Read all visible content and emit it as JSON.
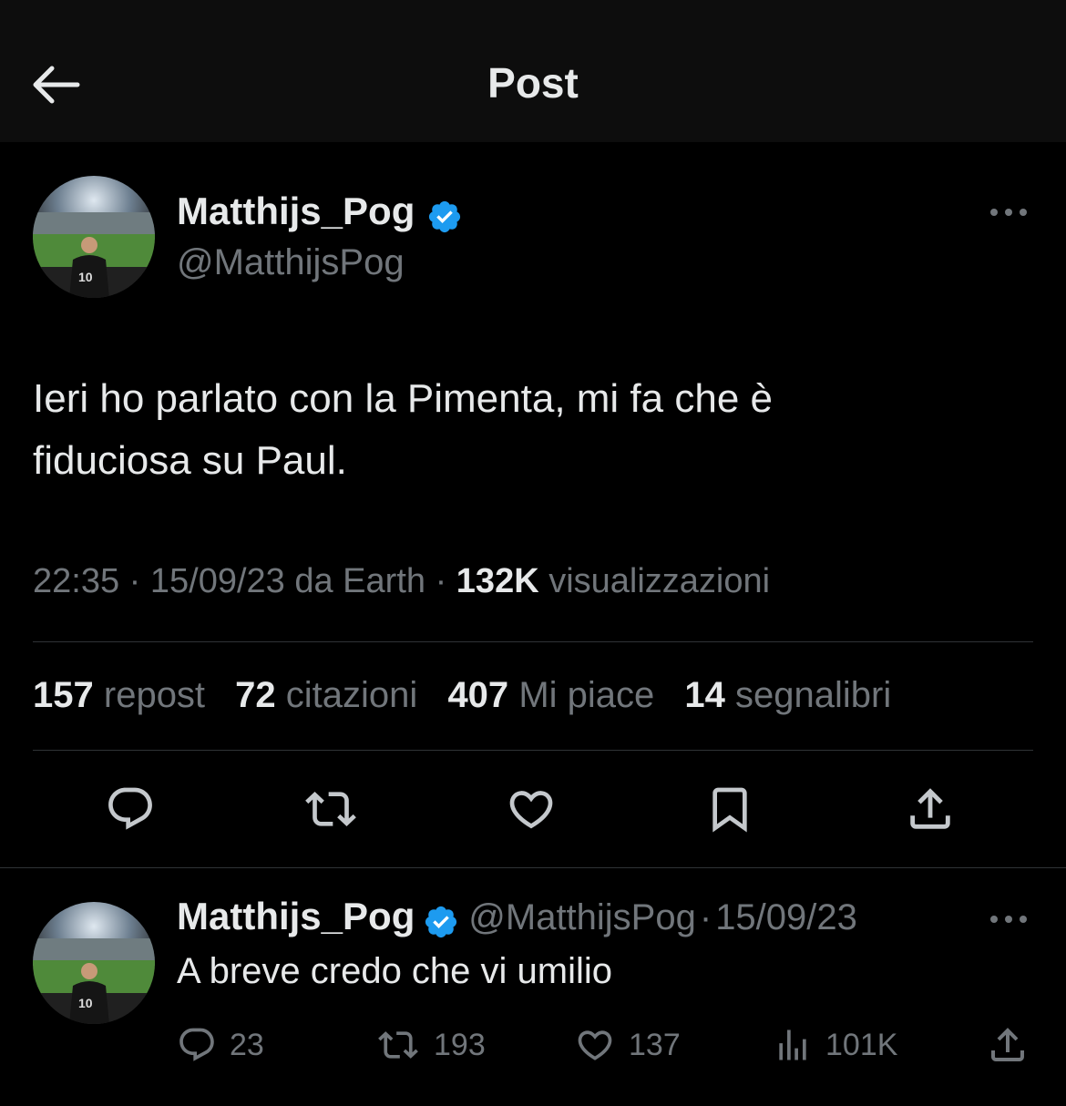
{
  "header": {
    "title": "Post"
  },
  "post": {
    "author_name": "Matthijs_Pog",
    "author_handle": "@MatthijsPog",
    "text_line1": "Ieri ho parlato con la Pimenta, mi fa che è",
    "text_line2": "fiduciosa su Paul.",
    "time": "22:35",
    "sep1": " · ",
    "date": "15/09/23",
    "source": " da Earth",
    "sep2": " · ",
    "views_count": "132K",
    "views_label": " visualizzazioni",
    "stats": {
      "reposts_count": "157",
      "reposts_label": "repost",
      "quotes_count": "72",
      "quotes_label": "citazioni",
      "likes_count": "407",
      "likes_label": "Mi piace",
      "bookmarks_count": "14",
      "bookmarks_label": "segnalibri"
    }
  },
  "reply": {
    "author_name": "Matthijs_Pog",
    "author_handle": "@MatthijsPog",
    "sep": "·",
    "date": "15/09/23",
    "text": "A breve credo che vi umilio",
    "replies": "23",
    "reposts": "193",
    "likes": "137",
    "views": "101K"
  },
  "colors": {
    "background": "#000000",
    "header_bg": "#0d0d0d",
    "text_primary": "#e7e9ea",
    "text_secondary": "#71767b",
    "verified_blue": "#1d9bf0",
    "divider": "#2f3336"
  },
  "icons": [
    "back-arrow-icon",
    "verified-badge-icon",
    "more-icon",
    "reply-icon",
    "repost-icon",
    "like-icon",
    "bookmark-icon",
    "share-icon",
    "views-icon"
  ]
}
